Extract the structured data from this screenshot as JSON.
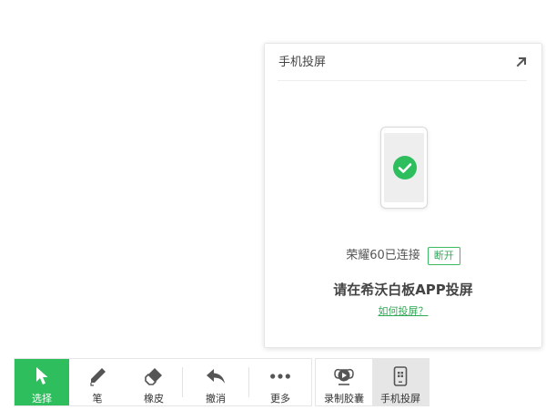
{
  "panel": {
    "title": "手机投屏",
    "device_status": "荣耀60已连接",
    "disconnect_label": "断开",
    "instruction": "请在希沃白板APP投屏",
    "help_link": "如何投屏？"
  },
  "toolbar": {
    "select_label": "选择",
    "pen_label": "笔",
    "eraser_label": "橡皮",
    "undo_label": "撤消",
    "more_label": "更多",
    "record_label": "录制胶囊",
    "mirror_label": "手机投屏"
  },
  "colors": {
    "accent_green": "#2fbe5e",
    "selected_gray": "#e6e6e6"
  },
  "icons": {
    "expand": "arrow-up-right-icon",
    "check": "check-circle-icon",
    "select": "cursor-arrow-icon",
    "pen": "pen-icon",
    "eraser": "eraser-icon",
    "undo": "undo-arrow-icon",
    "more": "ellipsis-icon",
    "record": "camera-capsule-icon",
    "mirror": "phone-cast-icon"
  }
}
